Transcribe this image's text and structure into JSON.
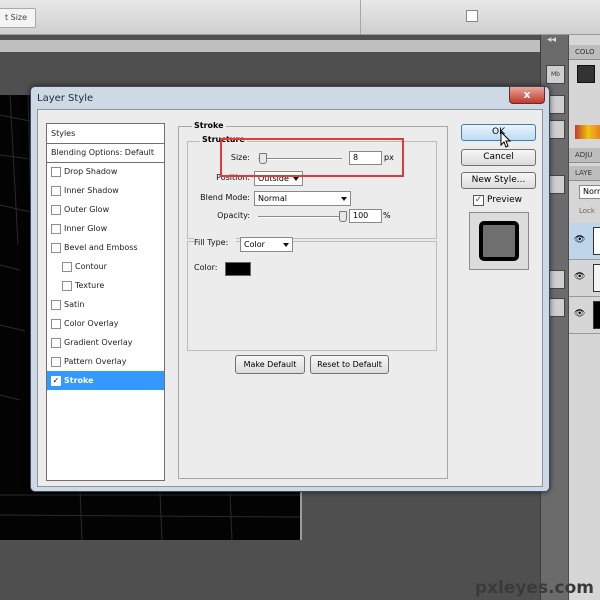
{
  "topbar": {
    "size_button": "t Size"
  },
  "panels": {
    "tabs": [
      "COLO",
      "ADJU",
      "LAYE"
    ],
    "blend_mode_partial": "Norm",
    "lock_partial": "Lock"
  },
  "dialog": {
    "title": "Layer Style",
    "close_symbol": "x",
    "styles_list": {
      "header": "Styles",
      "blending": "Blending Options: Default",
      "items": [
        {
          "label": "Drop Shadow",
          "checked": false
        },
        {
          "label": "Inner Shadow",
          "checked": false
        },
        {
          "label": "Outer Glow",
          "checked": false
        },
        {
          "label": "Inner Glow",
          "checked": false
        },
        {
          "label": "Bevel and Emboss",
          "checked": false
        },
        {
          "label": "Contour",
          "checked": false
        },
        {
          "label": "Texture",
          "checked": false
        },
        {
          "label": "Satin",
          "checked": false
        },
        {
          "label": "Color Overlay",
          "checked": false
        },
        {
          "label": "Gradient Overlay",
          "checked": false
        },
        {
          "label": "Pattern Overlay",
          "checked": false
        },
        {
          "label": "Stroke",
          "checked": true,
          "selected": true
        }
      ],
      "check_mark": "✓"
    },
    "stroke": {
      "group_title": "Stroke",
      "structure": {
        "title": "Structure",
        "size_label": "Size:",
        "size_value": "8",
        "size_unit": "px",
        "size_slider_fraction": 0.05,
        "position_label": "Position:",
        "position_value": "Outside",
        "blend_label": "Blend Mode:",
        "blend_value": "Normal",
        "opacity_label": "Opacity:",
        "opacity_value": "100",
        "opacity_unit": "%",
        "opacity_slider_fraction": 1.0
      },
      "fill": {
        "type_label": "Fill Type:",
        "type_value": "Color",
        "color_label": "Color:",
        "color_value": "#000000"
      },
      "make_default": "Make Default",
      "reset_default": "Reset to Default"
    },
    "buttons": {
      "ok": "OK",
      "cancel": "Cancel",
      "new_style": "New Style...",
      "preview": "Preview",
      "preview_checked": "✓"
    }
  },
  "watermark": "pxleyes.com",
  "colors": {
    "highlight": "#e53935",
    "selection": "#3399ff",
    "ok_border": "#3c7fb1"
  }
}
